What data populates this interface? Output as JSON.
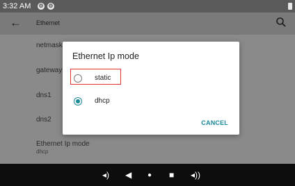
{
  "status_bar": {
    "time": "3:32 AM",
    "icons": [
      "notification-icon",
      "notification-icon",
      "battery-icon"
    ]
  },
  "app_bar": {
    "title": "Ethernet",
    "back_icon": "arrow-left-icon",
    "search_icon": "search-icon"
  },
  "settings_items": [
    {
      "label": "netmask"
    },
    {
      "label": "gateway"
    },
    {
      "label": "dns1"
    },
    {
      "label": "dns2"
    },
    {
      "label": "Ethernet Ip mode",
      "value": "dhcp"
    }
  ],
  "dialog": {
    "title": "Ethernet Ip mode",
    "options": [
      {
        "label": "static",
        "selected": false
      },
      {
        "label": "dhcp",
        "selected": true
      }
    ],
    "cancel_label": "CANCEL"
  },
  "nav_bar": {
    "icons": [
      "volume-down-icon",
      "back-icon",
      "home-icon",
      "recents-icon",
      "volume-up-icon"
    ]
  },
  "colors": {
    "accent": "#1a8a9a",
    "highlight_box": "#e03030",
    "nav_bg": "#0d0d0d"
  }
}
